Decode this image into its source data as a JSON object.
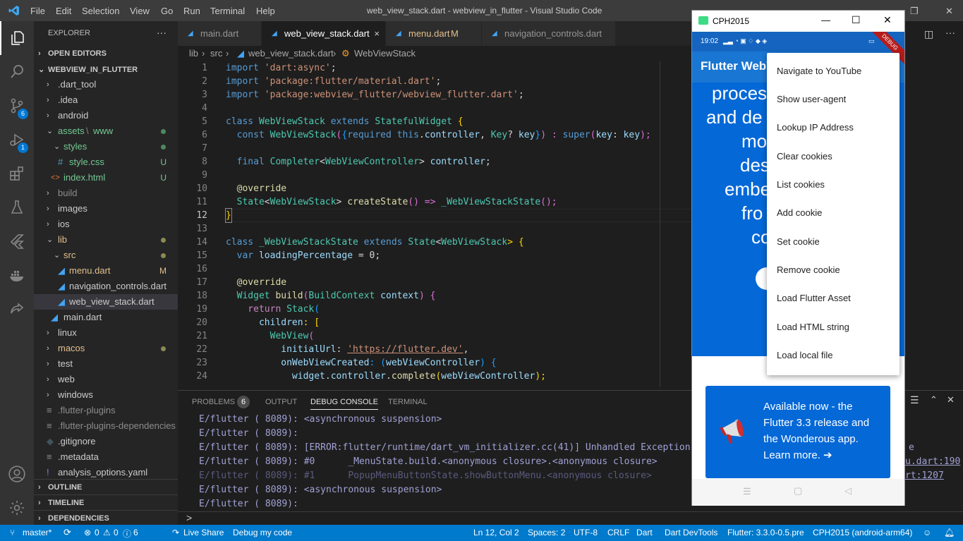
{
  "window": {
    "title": "web_view_stack.dart - webview_in_flutter - Visual Studio Code",
    "menu": [
      "File",
      "Edit",
      "Selection",
      "View",
      "Go",
      "Run",
      "Terminal",
      "Help"
    ]
  },
  "activity": {
    "scm_badge": "6",
    "debug_badge": "1"
  },
  "explorer": {
    "header": "EXPLORER",
    "more": "···",
    "open_editors": "OPEN EDITORS",
    "project": "WEBVIEW_IN_FLUTTER",
    "items": [
      {
        "label": ".dart_tool",
        "status": ""
      },
      {
        "label": ".idea",
        "status": ""
      },
      {
        "label": "android",
        "status": ""
      },
      {
        "label": "assets",
        "label2": "www",
        "status": "dot"
      },
      {
        "label": "styles",
        "status": "dot"
      },
      {
        "label": "style.css",
        "status": "U"
      },
      {
        "label": "index.html",
        "status": "U"
      },
      {
        "label": "build",
        "status": ""
      },
      {
        "label": "images",
        "status": ""
      },
      {
        "label": "ios",
        "status": ""
      },
      {
        "label": "lib",
        "status": "dot"
      },
      {
        "label": "src",
        "status": "dot"
      },
      {
        "label": "menu.dart",
        "status": "M"
      },
      {
        "label": "navigation_controls.dart",
        "status": ""
      },
      {
        "label": "web_view_stack.dart",
        "status": ""
      },
      {
        "label": "main.dart",
        "status": ""
      },
      {
        "label": "linux",
        "status": ""
      },
      {
        "label": "macos",
        "status": "dot"
      },
      {
        "label": "test",
        "status": ""
      },
      {
        "label": "web",
        "status": ""
      },
      {
        "label": "windows",
        "status": ""
      },
      {
        "label": ".flutter-plugins",
        "status": ""
      },
      {
        "label": ".flutter-plugins-dependencies",
        "status": ""
      },
      {
        "label": ".gitignore",
        "status": ""
      },
      {
        "label": ".metadata",
        "status": ""
      },
      {
        "label": "analysis_options.yaml",
        "status": ""
      }
    ],
    "outline": "OUTLINE",
    "timeline": "TIMELINE",
    "dependencies": "DEPENDENCIES"
  },
  "tabs": [
    {
      "label": "main.dart",
      "suffix": ""
    },
    {
      "label": "web_view_stack.dart",
      "suffix": "×"
    },
    {
      "label": "menu.dart",
      "suffix": "M"
    },
    {
      "label": "navigation_controls.dart",
      "suffix": ""
    }
  ],
  "breadcrumb": {
    "a": "lib",
    "b": "src",
    "c": "web_view_stack.dart",
    "d": "WebViewStack"
  },
  "line_numbers": [
    "1",
    "2",
    "3",
    "4",
    "5",
    "6",
    "7",
    "8",
    "9",
    "10",
    "11",
    "12",
    "13",
    "14",
    "15",
    "16",
    "17",
    "18",
    "19",
    "20",
    "21",
    "22",
    "23",
    "24"
  ],
  "code": {
    "l1a": "import ",
    "l1b": "'dart:async'",
    "l1c": ";",
    "l2a": "import ",
    "l2b": "'package:flutter/material.dart'",
    "l2c": ";",
    "l3a": "import ",
    "l3b": "'package:webview_flutter/webview_flutter.dart'",
    "l3c": ";",
    "l5a": "class ",
    "l5b": "WebViewStack",
    "l5c": " extends ",
    "l5d": "StatefulWidget",
    "l5e": " {",
    "l6a": "  const ",
    "l6b": "WebViewStack",
    "l6c": "(",
    "l6d": "{",
    "l6e": "required ",
    "l6f": "this",
    "l6g": ".",
    "l6h": "controller",
    "l6i": ", ",
    "l6j": "Key",
    "l6k": "? ",
    "l6l": "key",
    "l6m": "}",
    "l6n": ") : ",
    "l6o": "super",
    "l6p": "(",
    "l6q": "key",
    "l6r": ": ",
    "l6s": "key",
    "l6t": ");",
    "l8a": "  final ",
    "l8b": "Completer",
    "l8c": "<",
    "l8d": "WebViewController",
    "l8e": "> ",
    "l8f": "controller",
    "l8g": ";",
    "l10a": "  @override",
    "l11a": "  ",
    "l11b": "State",
    "l11c": "<",
    "l11d": "WebViewStack",
    "l11e": "> ",
    "l11f": "createState",
    "l11g": "() => ",
    "l11h": "_WebViewStackState",
    "l11i": "();",
    "l12a": "}",
    "l14a": "class ",
    "l14b": "_WebViewStackState",
    "l14c": " extends ",
    "l14d": "State",
    "l14e": "<",
    "l14f": "WebViewStack",
    "l14g": "> {",
    "l15a": "  var ",
    "l15b": "loadingPercentage",
    "l15c": " = 0;",
    "l17a": "  @override",
    "l18a": "  ",
    "l18b": "Widget",
    "l18c": " ",
    "l18d": "build",
    "l18e": "(",
    "l18f": "BuildContext",
    "l18g": " ",
    "l18h": "context",
    "l18i": ") {",
    "l19a": "    return ",
    "l19b": "Stack",
    "l19c": "(",
    "l20a": "      ",
    "l20b": "children",
    "l20c": ": [",
    "l21a": "        ",
    "l21b": "WebView",
    "l21c": "(",
    "l22a": "          ",
    "l22b": "initialUrl",
    "l22c": ": ",
    "l22d": "'https://flutter.dev'",
    "l22e": ",",
    "l23a": "          ",
    "l23b": "onWebViewCreated",
    "l23c": ": (",
    "l23d": "webViewController",
    "l23e": ") {",
    "l24a": "            ",
    "l24b": "widget",
    "l24c": ".",
    "l24d": "controller",
    "l24e": ".",
    "l24f": "complete",
    "l24g": "(",
    "l24h": "webViewController",
    "l24i": ");"
  },
  "panel": {
    "tabs": [
      "PROBLEMS",
      "OUTPUT",
      "DEBUG CONSOLE",
      "TERMINAL"
    ],
    "problems_count": "6",
    "lines": [
      "E/flutter ( 8089): <asynchronous suspension>",
      "E/flutter ( 8089):",
      "E/flutter ( 8089): [ERROR:flutter/runtime/dart_vm_initializer.cc(41)] Unhandled Exception:",
      "E/flutter ( 8089): #0      _MenuState.build.<anonymous closure>.<anonymous closure>",
      "E/flutter ( 8089): #1      PopupMenuButtonState.showButtonMenu.<anonymous closure>",
      "E/flutter ( 8089): <asynchronous suspension>",
      "E/flutter ( 8089):"
    ],
    "right_tail": [
      "e",
      "u.dart:190",
      "rt:1207"
    ],
    "prompt": ">"
  },
  "statusbar": {
    "branch": "master*",
    "errors": "0",
    "warnings": "0",
    "infos": "6",
    "live_share": "Live Share",
    "debug": "Debug my code",
    "position": "Ln 12, Col 2",
    "spaces": "Spaces: 2",
    "encoding": "UTF-8",
    "eol": "CRLF",
    "language": "Dart",
    "devtools": "Dart DevTools",
    "flutter": "Flutter: 3.3.0-0.5.pre",
    "device": "CPH2015 (android-arm64)"
  },
  "emulator": {
    "title": "CPH2015",
    "time": "19:02",
    "debug_ribbon": "DEBUG",
    "appbar_title": "Flutter WebVi",
    "hero_lines": [
      "proces",
      "and de",
      "mo",
      "des",
      "embe",
      "fro",
      "co"
    ],
    "menu_items": [
      "Navigate to YouTube",
      "Show user-agent",
      "Lookup IP Address",
      "Clear cookies",
      "List cookies",
      "Add cookie",
      "Set cookie",
      "Remove cookie",
      "Load Flutter Asset",
      "Load HTML string",
      "Load local file"
    ],
    "banner_text": "Available now - the Flutter 3.3 release and the Wonderous app. Learn more. ➔"
  }
}
